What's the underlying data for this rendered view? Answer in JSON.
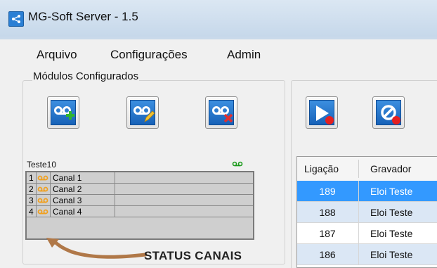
{
  "window": {
    "title": "MG-Soft Server - 1.5"
  },
  "menu": {
    "items": [
      "Arquivo",
      "Configurações",
      "Admin"
    ]
  },
  "modules_group": {
    "legend": "Módulos Configurados"
  },
  "module": {
    "name": "Teste10",
    "channels": [
      {
        "num": "1",
        "label": "Canal 1"
      },
      {
        "num": "2",
        "label": "Canal 2"
      },
      {
        "num": "3",
        "label": "Canal 3"
      },
      {
        "num": "4",
        "label": "Canal 4"
      }
    ]
  },
  "annotation": {
    "text": "STATUS CANAIS"
  },
  "toolbar_left": {
    "icons": [
      "voicemail-add-icon",
      "voicemail-edit-icon",
      "voicemail-delete-icon"
    ]
  },
  "toolbar_right": {
    "icons": [
      "play-record-icon",
      "stop-record-icon"
    ]
  },
  "recordings": {
    "headers": [
      "Ligação",
      "Gravador"
    ],
    "rows": [
      {
        "ligacao": "189",
        "gravador": "Eloi Teste",
        "selected": true
      },
      {
        "ligacao": "188",
        "gravador": "Eloi Teste",
        "selected": false
      },
      {
        "ligacao": "187",
        "gravador": "Eloi Teste",
        "selected": false
      },
      {
        "ligacao": "186",
        "gravador": "Eloi Teste",
        "selected": false
      }
    ]
  },
  "colors": {
    "selected_row": "#3399ff",
    "alt_row": "#dbe7f5",
    "channel_icon": "#f0a020",
    "annotation_arrow": "#b07848"
  }
}
